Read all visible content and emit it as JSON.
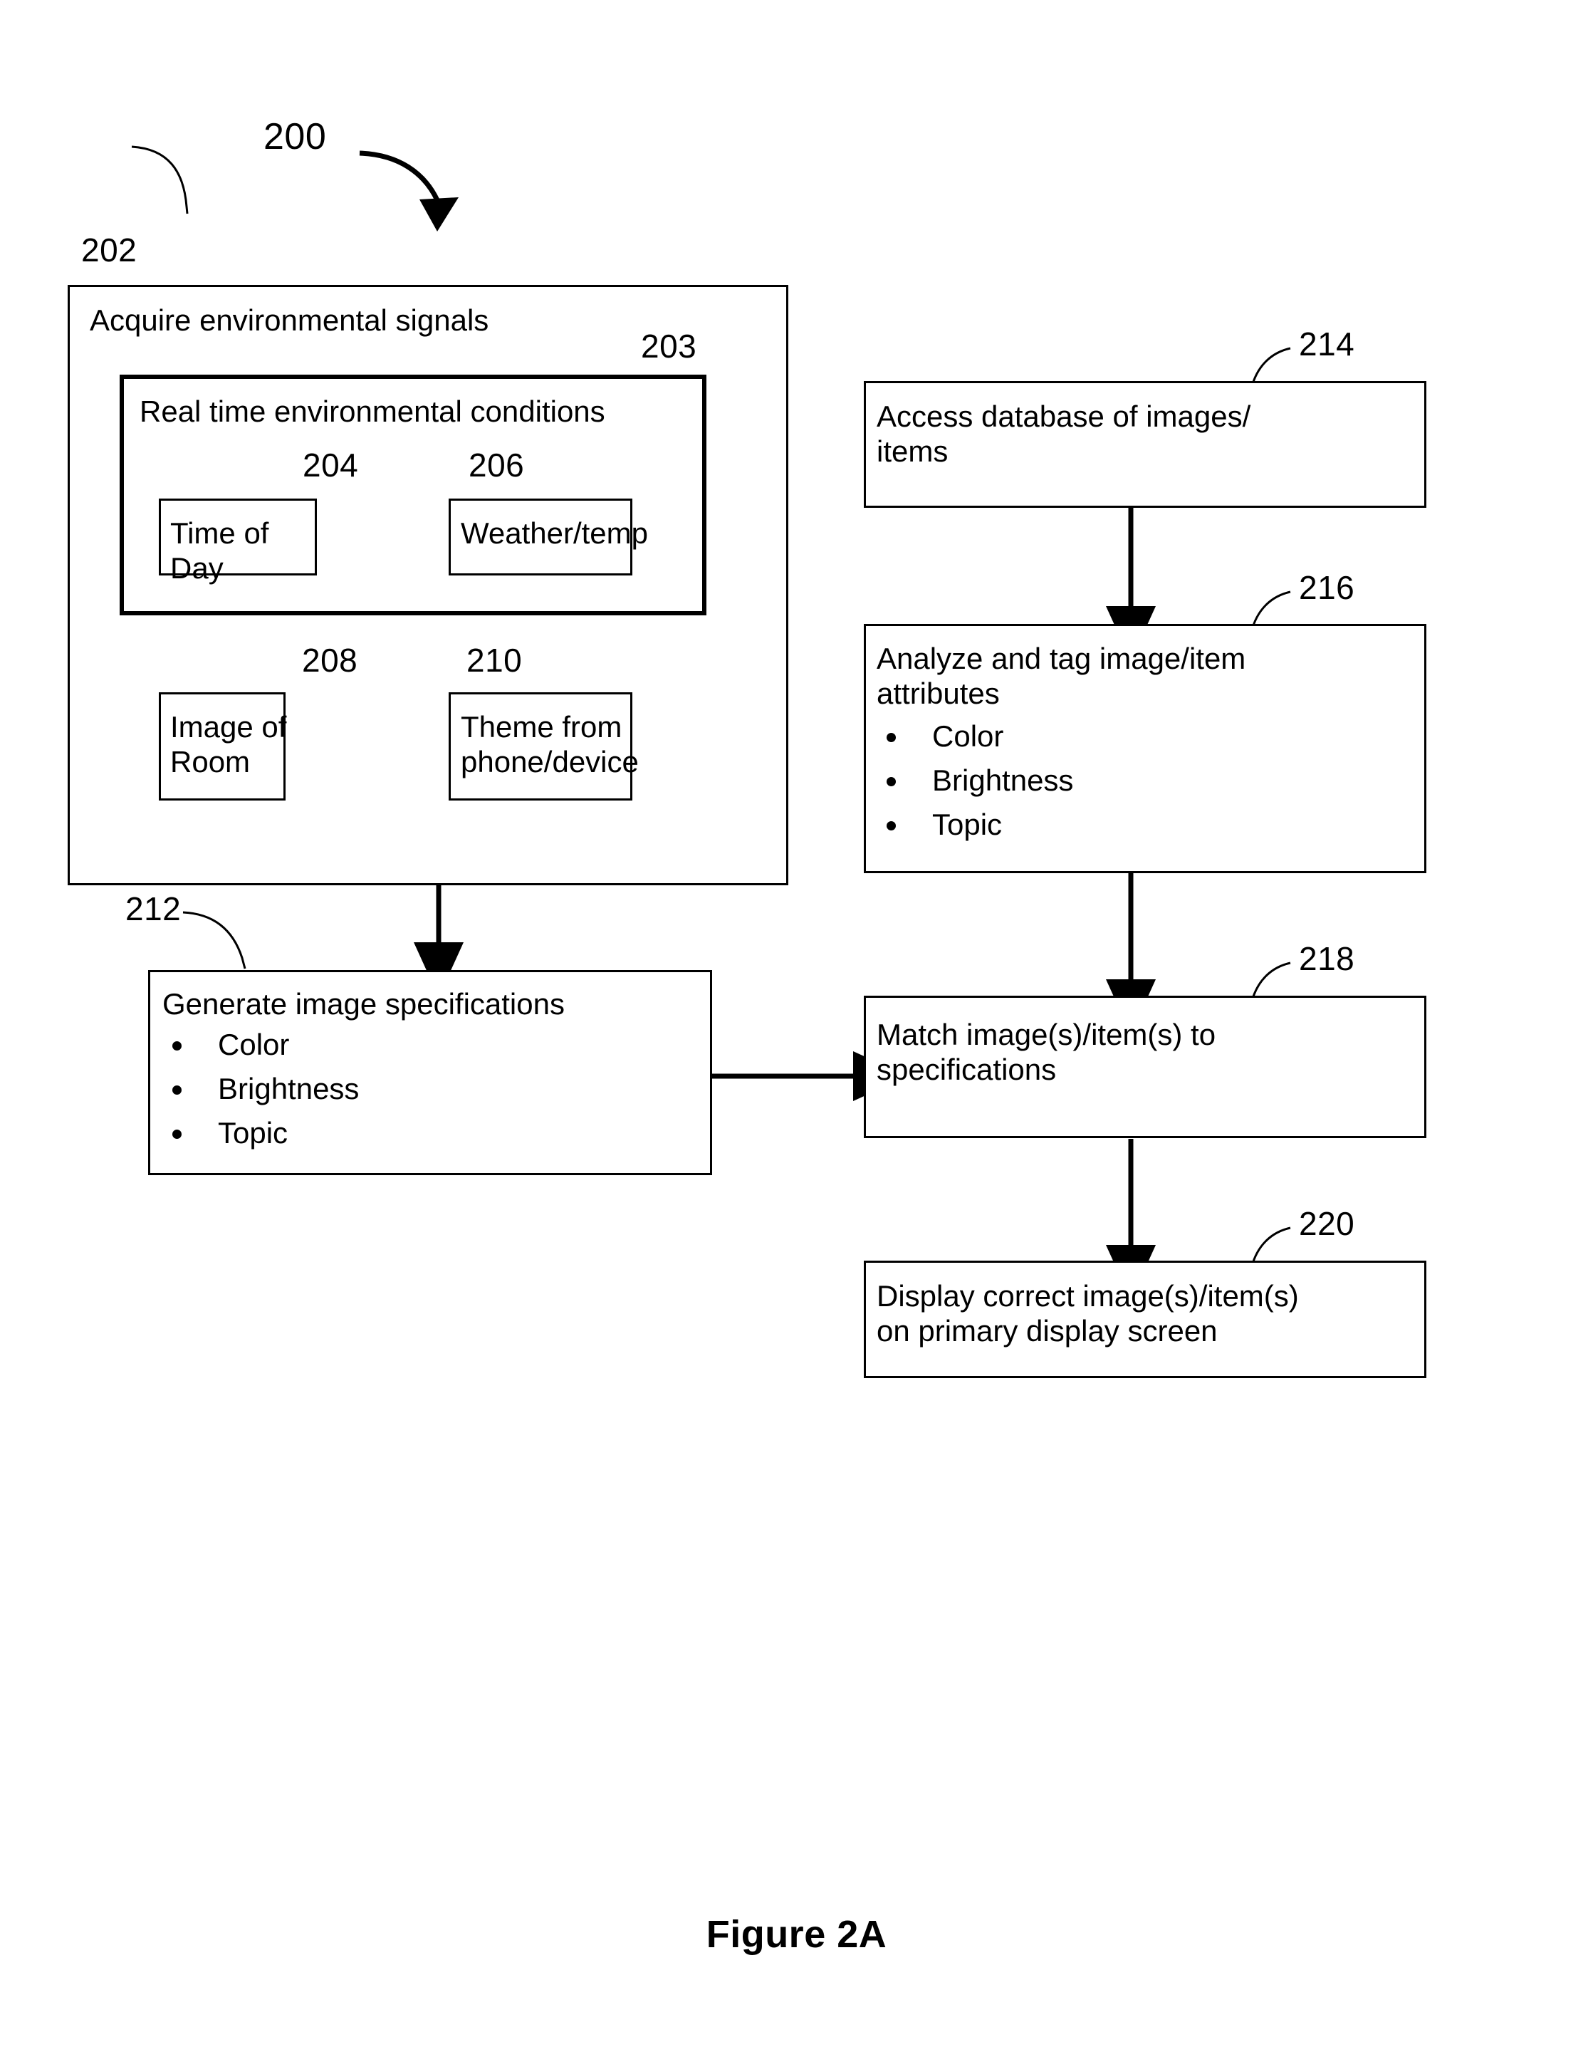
{
  "figure": {
    "caption": "Figure 2A",
    "flow_ref": "200"
  },
  "nodes": {
    "acquire": {
      "ref": "202",
      "title": "Acquire environmental signals"
    },
    "realtime": {
      "ref": "203",
      "title": "Real time environmental conditions"
    },
    "time_of_day": {
      "ref": "204",
      "title": "Time of Day"
    },
    "weather_temp": {
      "ref": "206",
      "title": "Weather/temp"
    },
    "image_of_room": {
      "ref": "208",
      "title": "Image of\nRoom"
    },
    "theme_from_device": {
      "ref": "210",
      "title": "Theme from\nphone/device"
    },
    "generate_specs": {
      "ref": "212",
      "title": "Generate image specifications",
      "bullets": [
        "Color",
        "Brightness",
        "Topic"
      ]
    },
    "access_database": {
      "ref": "214",
      "title": "Access database of images/\nitems"
    },
    "analyze_tag": {
      "ref": "216",
      "title": "Analyze and tag image/item\nattributes",
      "bullets": [
        "Color",
        "Brightness",
        "Topic"
      ]
    },
    "match_specs": {
      "ref": "218",
      "title": "Match image(s)/item(s) to\nspecifications"
    },
    "display_result": {
      "ref": "220",
      "title": "Display correct image(s)/item(s)\non primary display screen"
    }
  },
  "colors": {
    "ink": "#000000",
    "paper": "#ffffff"
  }
}
